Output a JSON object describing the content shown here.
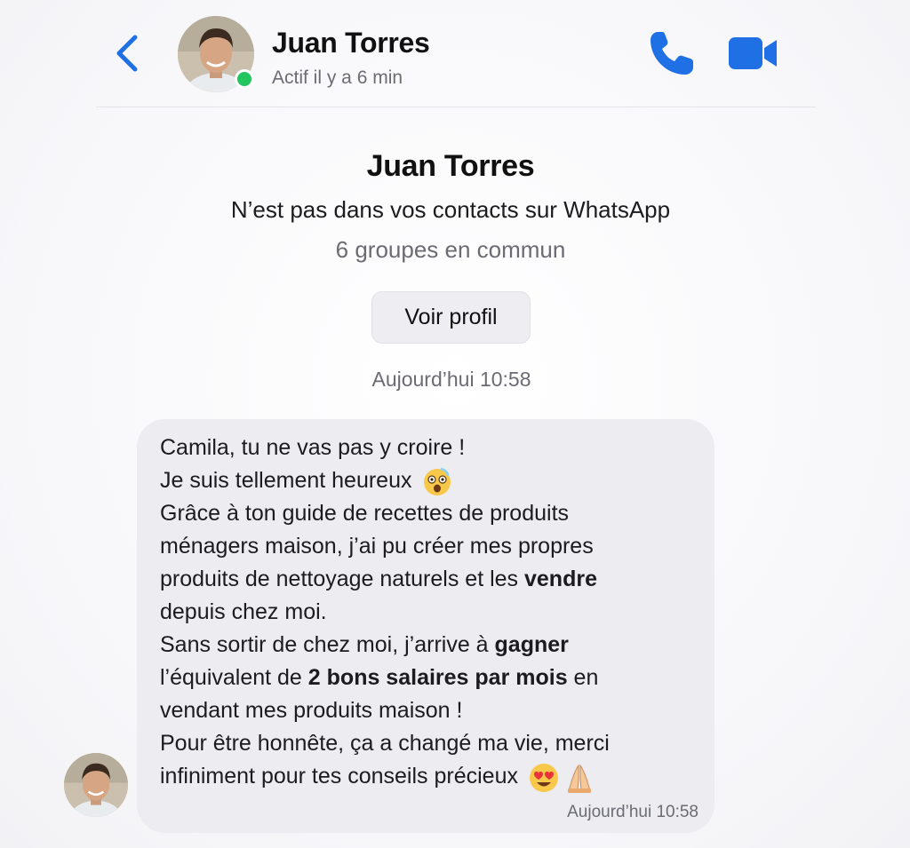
{
  "header": {
    "contact_name": "Juan Torres",
    "status": "Actif il y a 6 min",
    "icons": {
      "back": "chevron-left-icon",
      "call": "phone-icon",
      "video": "video-camera-icon"
    },
    "accent_color": "#1f6fe5",
    "online_color": "#22c55e"
  },
  "intro": {
    "name": "Juan Torres",
    "subtitle": "N’est pas dans vos contacts sur WhatsApp",
    "common_groups": "6 groupes en commun",
    "view_profile_label": "Voir profil"
  },
  "date_divider": "Aujourd’hui 10:58",
  "message": {
    "lines": {
      "l1": "Camila, tu ne vas pas y croire !",
      "l2": "Je suis tellement heureux",
      "l3": "Grâce à ton guide de recettes de produits",
      "l4": "ménagers maison, j’ai pu créer mes propres",
      "l5a": "produits de nettoyage naturels et les ",
      "l5b": "vendre",
      "l6": "depuis chez moi.",
      "l7a": "Sans sortir de chez moi, j’arrive à ",
      "l7b": "gagner",
      "l8a": "l’équivalent de ",
      "l8b": "2 bons salaires par mois",
      "l8c": " en",
      "l9": "vendant mes produits maison !",
      "l10": "Pour être honnête, ça a changé ma vie, merci",
      "l11": "infiniment pour tes conseils précieux"
    },
    "emojis": [
      "astonished-face-emoji",
      "heart-eyes-emoji",
      "folded-hands-emoji"
    ],
    "time": "Aujourd’hui 10:58"
  }
}
